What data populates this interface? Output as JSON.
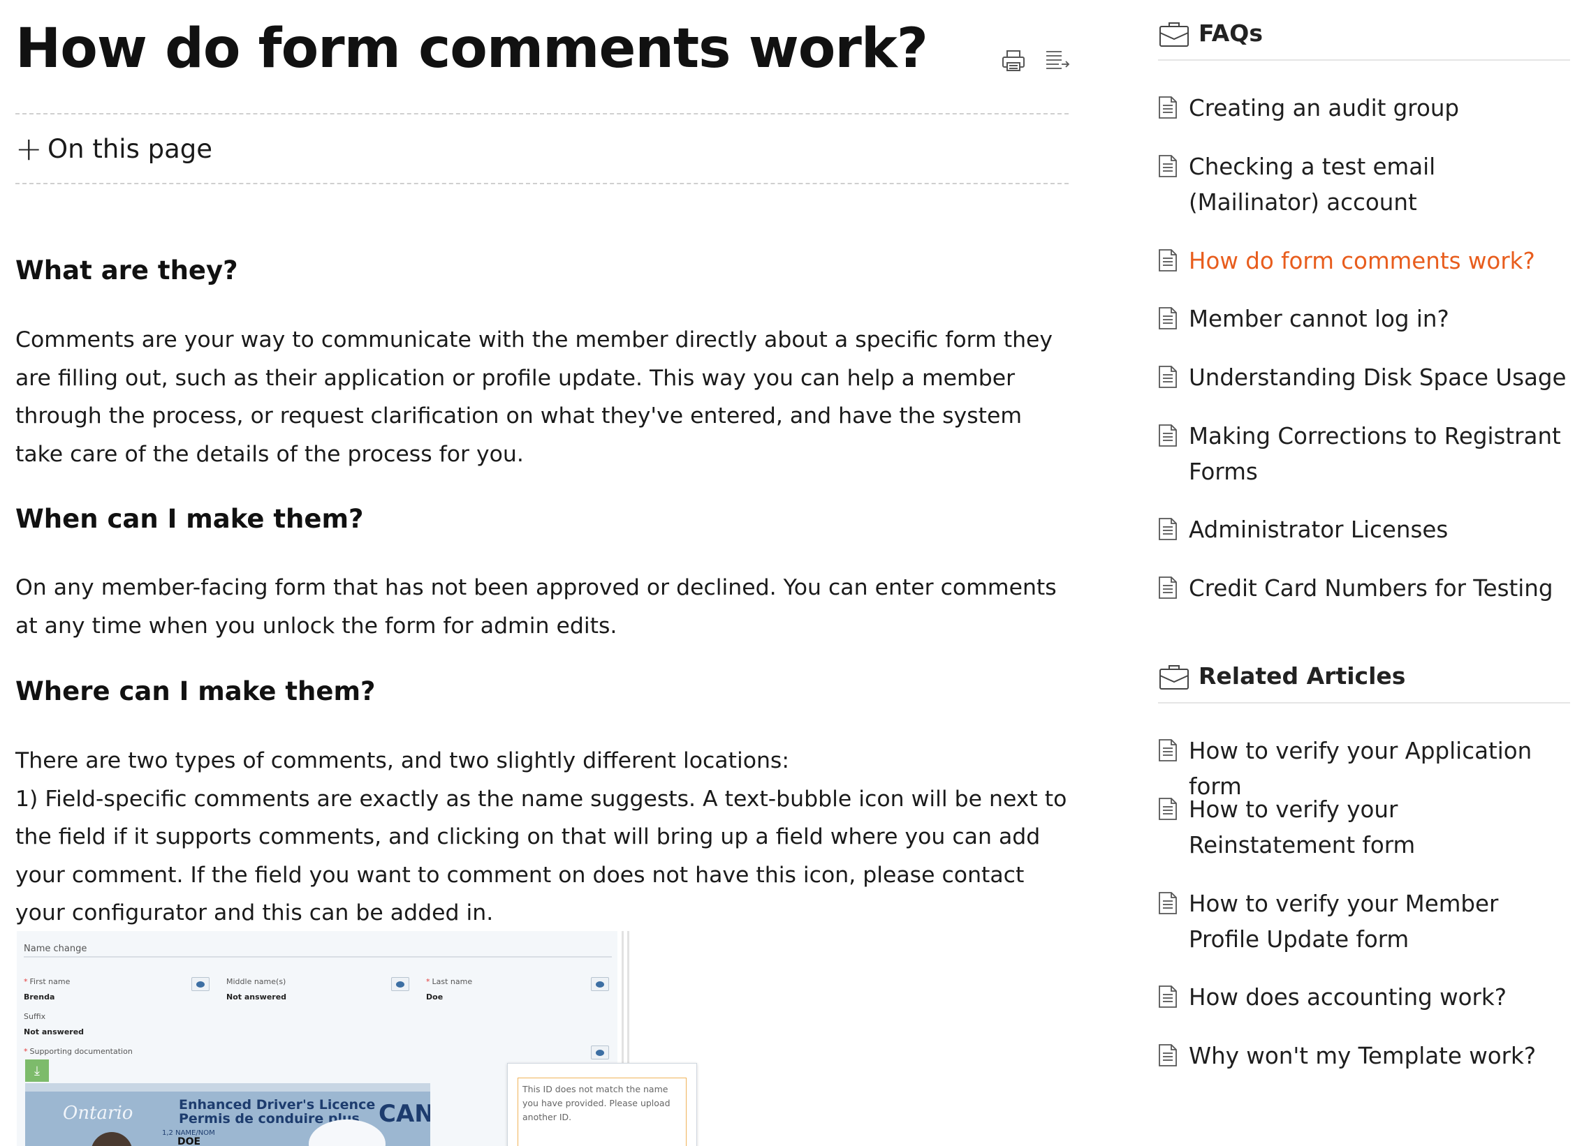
{
  "article": {
    "title": "How do form comments work?",
    "tools": [
      {
        "name": "print-icon",
        "label": ""
      },
      {
        "name": "text-list-icon",
        "label": ""
      }
    ],
    "on_this_page": {
      "icon": "plus-icon",
      "label": "On this page"
    },
    "sections": [
      {
        "heading": "What are they?",
        "paragraphs": [
          "Comments are your way to communicate with the member directly about a specific form they are filling out, such as their application or profile update. This way you can help a member through the process, or request clarification on what they've entered, and have the system take care of the details of the process for you."
        ]
      },
      {
        "heading": "When can I make them?",
        "paragraphs": [
          "On any member-facing form that has not been approved or declined. You can enter comments at any time when you unlock the form for admin edits."
        ]
      },
      {
        "heading": "Where can I make them?",
        "paragraphs": [
          "There are two types of comments, and two slightly different locations:",
          "1) Field-specific comments are exactly as the name suggests. A text-bubble icon will be next to the field if it supports comments, and clicking on that will bring up a field where you can add your comment. If the field you want to comment on does not have this icon, please contact your configurator and this can be added in."
        ]
      }
    ],
    "screenshot": {
      "section_title": "Name change",
      "fields": [
        {
          "label": "First name",
          "required": true,
          "value": "Brenda"
        },
        {
          "label": "Middle name(s)",
          "required": false,
          "value": "Not answered"
        },
        {
          "label": "Last name",
          "required": true,
          "value": "Doe"
        },
        {
          "label": "Suffix",
          "required": false,
          "value": "Not answered"
        },
        {
          "label": "Supporting documentation",
          "required": true,
          "value": ""
        }
      ],
      "licence": {
        "province": "Ontario",
        "title_en": "Enhanced Driver's Licence",
        "title_fr": "Permis de conduire plus",
        "country": "CAN",
        "name_label": "1,2 NAME/NOM",
        "name": "DOE"
      },
      "comment_text": "This ID does not match the name you have provided. Please upload another ID."
    }
  },
  "sidebar": {
    "faqs": {
      "title": "FAQs",
      "icon": "briefcase-icon",
      "items": [
        {
          "label": "Creating an audit group",
          "active": false
        },
        {
          "label": "Checking a test email (Mailinator) account",
          "active": false
        },
        {
          "label": "How do form comments work?",
          "active": true
        },
        {
          "label": "Member cannot log in?",
          "active": false
        },
        {
          "label": "Understanding Disk Space Usage",
          "active": false
        },
        {
          "label": "Making Corrections to Registrant Forms",
          "active": false
        },
        {
          "label": "Administrator Licenses",
          "active": false
        },
        {
          "label": "Credit Card Numbers for Testing",
          "active": false
        }
      ]
    },
    "related": {
      "title": "Related Articles",
      "icon": "briefcase-icon",
      "items": [
        {
          "label": "How to verify your Application form"
        },
        {
          "label": "How to verify your Reinstatement form"
        },
        {
          "label": "How to verify your Member Profile Update form"
        },
        {
          "label": "How does accounting work?"
        },
        {
          "label": "Why won't my Template work?"
        }
      ]
    }
  },
  "colors": {
    "active_link": "#e85d1d",
    "text": "#1a1a1a",
    "divider": "#cfcfcf"
  }
}
